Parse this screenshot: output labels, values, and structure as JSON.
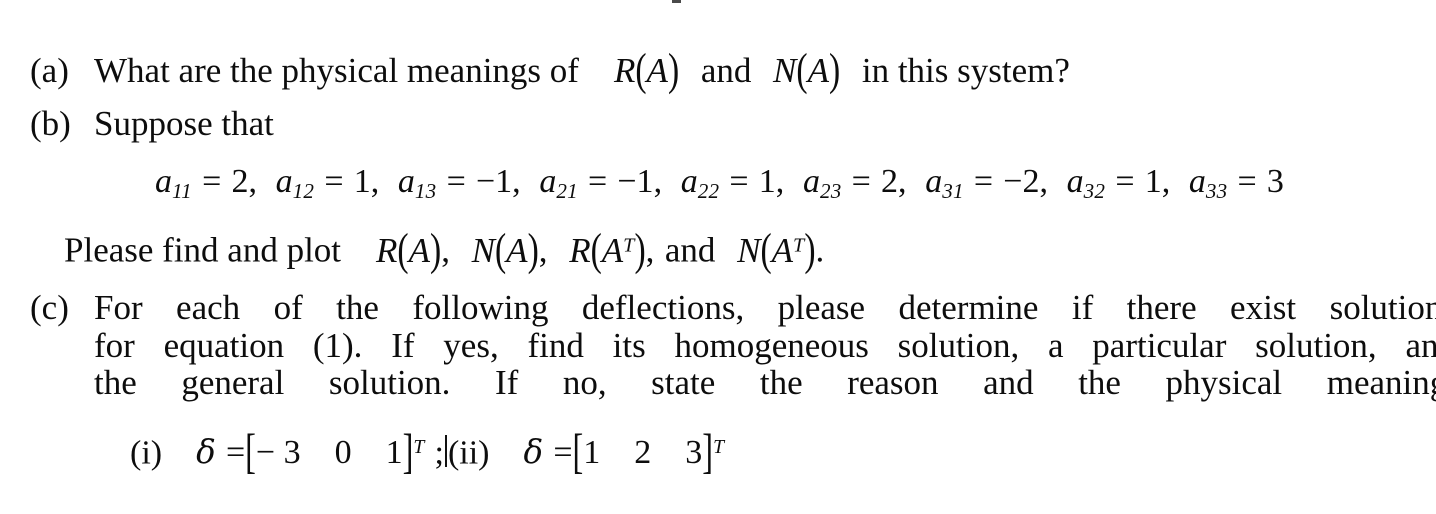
{
  "document": {
    "background_color": "#ffffff",
    "text_color": "#0d0d0d",
    "items": [
      {
        "marker": "(a)",
        "text_before_math": "What are the physical meanings of",
        "math_1": "R(A)",
        "conjunction": "and",
        "math_2": "N(A)",
        "text_after_math": "in this system?"
      },
      {
        "marker": "(b)",
        "text": "Suppose that"
      },
      {
        "marker": "(c)",
        "line_1": "For each of the following deflections, please determine if there exist solutions",
        "line_2": "for equation (1). If yes, find its homogeneous solution, a particular solution, and",
        "line_3": "the general solution. If no, state the reason and the physical meaning."
      }
    ],
    "coefficients": [
      {
        "name": "a",
        "subscript": "11",
        "relation": "=",
        "value": "2"
      },
      {
        "name": "a",
        "subscript": "12",
        "relation": "=",
        "value": "1"
      },
      {
        "name": "a",
        "subscript": "13",
        "relation": "=",
        "value": "−1"
      },
      {
        "name": "a",
        "subscript": "21",
        "relation": "=",
        "value": "−1"
      },
      {
        "name": "a",
        "subscript": "22",
        "relation": "=",
        "value": "1"
      },
      {
        "name": "a",
        "subscript": "23",
        "relation": "=",
        "value": "2"
      },
      {
        "name": "a",
        "subscript": "31",
        "relation": "=",
        "value": "−2"
      },
      {
        "name": "a",
        "subscript": "32",
        "relation": "=",
        "value": "1"
      },
      {
        "name": "a",
        "subscript": "33",
        "relation": "=",
        "value": "3"
      }
    ],
    "find_and_plot": {
      "lead_text": "Please find and plot",
      "targets": [
        "R(A)",
        "N(A)",
        "R(Aᵀ)"
      ],
      "conjunction": "and",
      "last_target": "N(Aᵀ).",
      "separator": ","
    },
    "deflections": [
      {
        "marker": "(i)",
        "symbol": "δ",
        "relation": "=",
        "open_bracket": "[",
        "components": [
          "− 3",
          "0",
          "1"
        ],
        "close_bracket": "]",
        "transpose": "T",
        "terminator": ";"
      },
      {
        "marker": "(ii)",
        "symbol": "δ",
        "relation": "=",
        "open_bracket": "[",
        "components": [
          "1",
          "2",
          "3"
        ],
        "close_bracket": "]",
        "transpose": "T",
        "terminator": ""
      }
    ],
    "cursor": {
      "present": true,
      "description": "text-caret"
    },
    "symbols": {
      "R": "R",
      "N": "N",
      "A": "A",
      "open_paren": "(",
      "close_paren": ")",
      "equals": "=",
      "comma": ",",
      "period": ".",
      "transpose_mark": "T"
    }
  }
}
